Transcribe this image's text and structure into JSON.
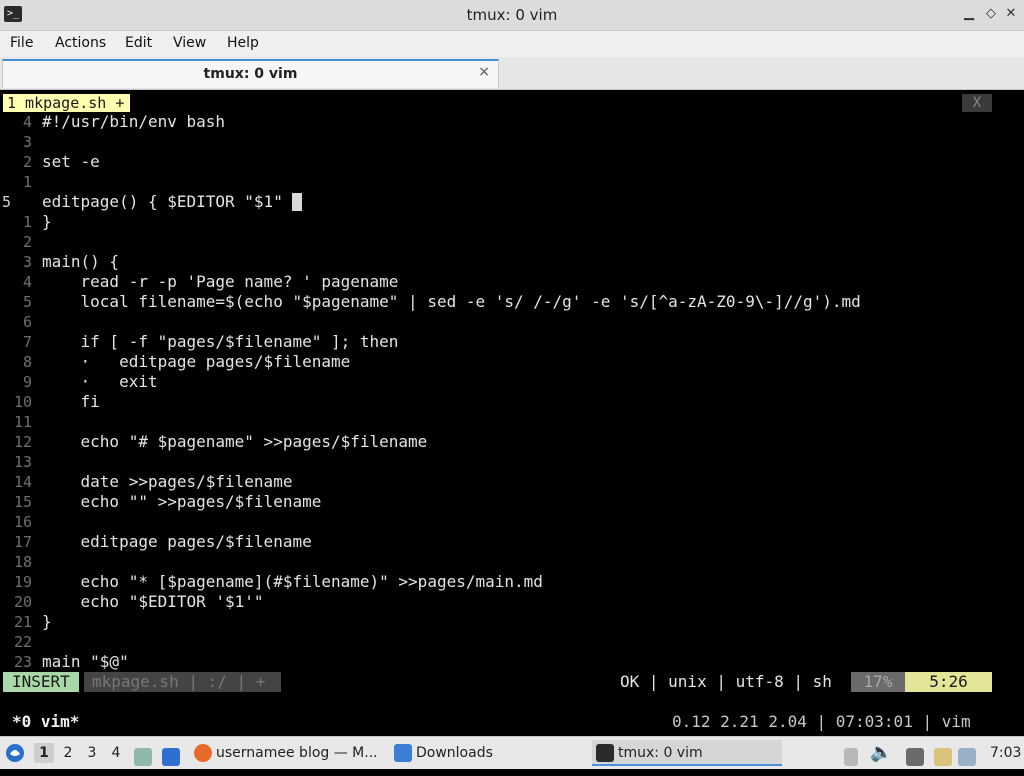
{
  "window": {
    "title": "tmux: 0 vim",
    "app_icon_glyph": ">_",
    "controls": [
      "minimize",
      "maximize",
      "close"
    ]
  },
  "menu": [
    "File",
    "Actions",
    "Edit",
    "View",
    "Help"
  ],
  "tab": {
    "label": "tmux: 0 vim",
    "close_glyph": "×"
  },
  "vim": {
    "buffer_tab": "1  mkpage.sh  +",
    "buffer_close": "X",
    "lines": [
      {
        "num": "4",
        "text": "#!/usr/bin/env bash"
      },
      {
        "num": "3",
        "text": ""
      },
      {
        "num": "2",
        "text": "set -e"
      },
      {
        "num": "1",
        "text": ""
      },
      {
        "num": "5",
        "text": "editpage() { $EDITOR \"$1\"",
        "current": true
      },
      {
        "num": "1",
        "text": "}"
      },
      {
        "num": "2",
        "text": ""
      },
      {
        "num": "3",
        "text": "main() {"
      },
      {
        "num": "4",
        "text": "    read -r -p 'Page name? ' pagename"
      },
      {
        "num": "5",
        "text": "    local filename=$(echo \"$pagename\" | sed -e 's/ /-/g' -e 's/[^a-zA-Z0-9\\-]//g').md"
      },
      {
        "num": "6",
        "text": ""
      },
      {
        "num": "7",
        "text": "    if [ -f \"pages/$filename\" ]; then"
      },
      {
        "num": "8",
        "text": "    ·   editpage pages/$filename"
      },
      {
        "num": "9",
        "text": "    ·   exit"
      },
      {
        "num": "10",
        "text": "    fi"
      },
      {
        "num": "11",
        "text": ""
      },
      {
        "num": "12",
        "text": "    echo \"# $pagename\" >>pages/$filename"
      },
      {
        "num": "13",
        "text": ""
      },
      {
        "num": "14",
        "text": "    date >>pages/$filename"
      },
      {
        "num": "15",
        "text": "    echo \"\" >>pages/$filename"
      },
      {
        "num": "16",
        "text": ""
      },
      {
        "num": "17",
        "text": "    editpage pages/$filename"
      },
      {
        "num": "18",
        "text": ""
      },
      {
        "num": "19",
        "text": "    echo \"* [$pagename](#$filename)\" >>pages/main.md"
      },
      {
        "num": "20",
        "text": "    echo \"$EDITOR '$1'\""
      },
      {
        "num": "21",
        "text": "}"
      },
      {
        "num": "22",
        "text": ""
      },
      {
        "num": "23",
        "text": "main \"$@\""
      }
    ],
    "status": {
      "mode": "INSERT",
      "file": "mkpage.sh  |  :/  |  +",
      "right": "OK  |  unix  |  utf-8  |  sh",
      "percent": "17%",
      "position": "5:26"
    }
  },
  "tmux": {
    "window": "*0 vim*",
    "right": "0.12 2.21 2.04 | 07:03:01 | vim"
  },
  "taskbar": {
    "workspaces": [
      "1",
      "2",
      "3",
      "4"
    ],
    "active_workspace": "1",
    "tasks": [
      {
        "label": "usernamee blog — M...",
        "icon": "firefox-icon"
      },
      {
        "label": "Downloads",
        "icon": "folder-icon"
      },
      {
        "label": "tmux: 0 vim",
        "icon": "terminal-icon"
      }
    ],
    "clock": "7:03"
  }
}
